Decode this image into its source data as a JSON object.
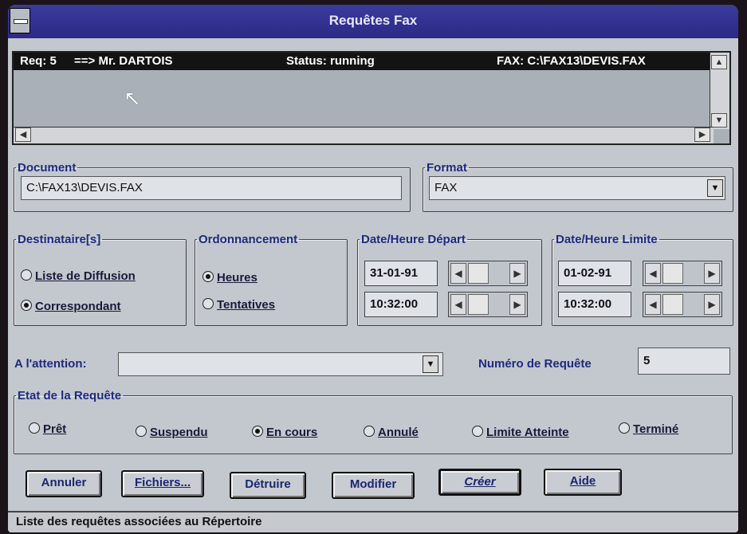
{
  "window": {
    "title": "Requêtes Fax"
  },
  "queue": {
    "selected_row": {
      "req": "Req: 5",
      "recipient": "==> Mr. DARTOIS",
      "status": "Status: running",
      "fax": "FAX: C:\\FAX13\\DEVIS.FAX"
    },
    "scroll_icons": {
      "up": "arrow-up-icon",
      "down": "arrow-down-icon",
      "left": "arrow-left-icon",
      "right": "arrow-right-icon"
    }
  },
  "document": {
    "legend": "Document",
    "value": "C:\\FAX13\\DEVIS.FAX"
  },
  "format": {
    "legend": "Format",
    "value": "FAX"
  },
  "destinataires": {
    "legend": "Destinataire[s]",
    "options": [
      {
        "label": "Liste de Diffusion",
        "selected": false
      },
      {
        "label": "Correspondant",
        "selected": true
      }
    ]
  },
  "ordonnancement": {
    "legend": "Ordonnancement",
    "options": [
      {
        "label": "Heures",
        "selected": true
      },
      {
        "label": "Tentatives",
        "selected": false
      }
    ]
  },
  "depart": {
    "legend": "Date/Heure Départ",
    "date": "31-01-91",
    "time": "10:32:00"
  },
  "limite": {
    "legend": "Date/Heure Limite",
    "date": "01-02-91",
    "time": "10:32:00"
  },
  "attention": {
    "label": "A l'attention:",
    "value": ""
  },
  "numero": {
    "label": "Numéro de Requête",
    "value": "5"
  },
  "etat": {
    "legend": "Etat de la Requête",
    "options": [
      {
        "label": "Prêt",
        "selected": false
      },
      {
        "label": "Suspendu",
        "selected": false
      },
      {
        "label": "En cours",
        "selected": true
      },
      {
        "label": "Annulé",
        "selected": false
      },
      {
        "label": "Limite Atteinte",
        "selected": false
      },
      {
        "label": "Terminé",
        "selected": false
      }
    ]
  },
  "buttons": {
    "annuler": "Annuler",
    "fichiers": "Fichiers...",
    "detruire": "Détruire",
    "modifier": "Modifier",
    "creer": "Créer",
    "aide": "Aide"
  },
  "statusbar": {
    "text": "Liste des requêtes associées au Répertoire"
  },
  "colors": {
    "title_bar": "#2c2a86",
    "label_blue": "#1d2b80",
    "face": "#c3c7ce",
    "selection": "#131313"
  }
}
